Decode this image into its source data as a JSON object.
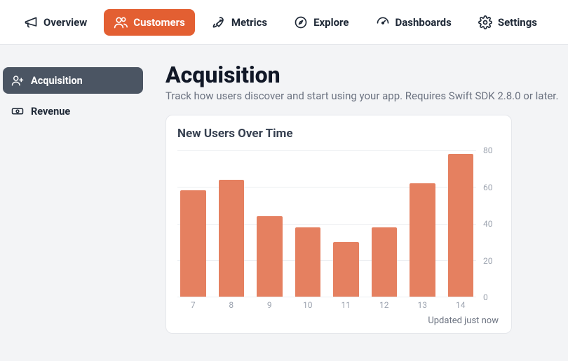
{
  "nav": {
    "items": [
      {
        "label": "Overview",
        "icon": "megaphone"
      },
      {
        "label": "Customers",
        "icon": "users",
        "active": true
      },
      {
        "label": "Metrics",
        "icon": "rocket"
      },
      {
        "label": "Explore",
        "icon": "compass"
      },
      {
        "label": "Dashboards",
        "icon": "gauge"
      },
      {
        "label": "Settings",
        "icon": "gear"
      }
    ]
  },
  "sidebar": {
    "items": [
      {
        "label": "Acquisition",
        "icon": "user-plus",
        "active": true
      },
      {
        "label": "Revenue",
        "icon": "banknote"
      }
    ]
  },
  "page": {
    "title": "Acquisition",
    "subtitle": "Track how users discover and start using your app. Requires Swift SDK 2.8.0 or later."
  },
  "card": {
    "title": "New Users Over Time",
    "footer": "Updated just now"
  },
  "chart_data": {
    "type": "bar",
    "title": "New Users Over Time",
    "xlabel": "",
    "ylabel": "",
    "categories": [
      "7",
      "8",
      "9",
      "10",
      "11",
      "12",
      "13",
      "14"
    ],
    "values": [
      58,
      64,
      44,
      38,
      30,
      38,
      62,
      78
    ],
    "ylim": [
      0,
      80
    ],
    "yticks": [
      0,
      20,
      40,
      60,
      80
    ],
    "color": "#e58060"
  }
}
